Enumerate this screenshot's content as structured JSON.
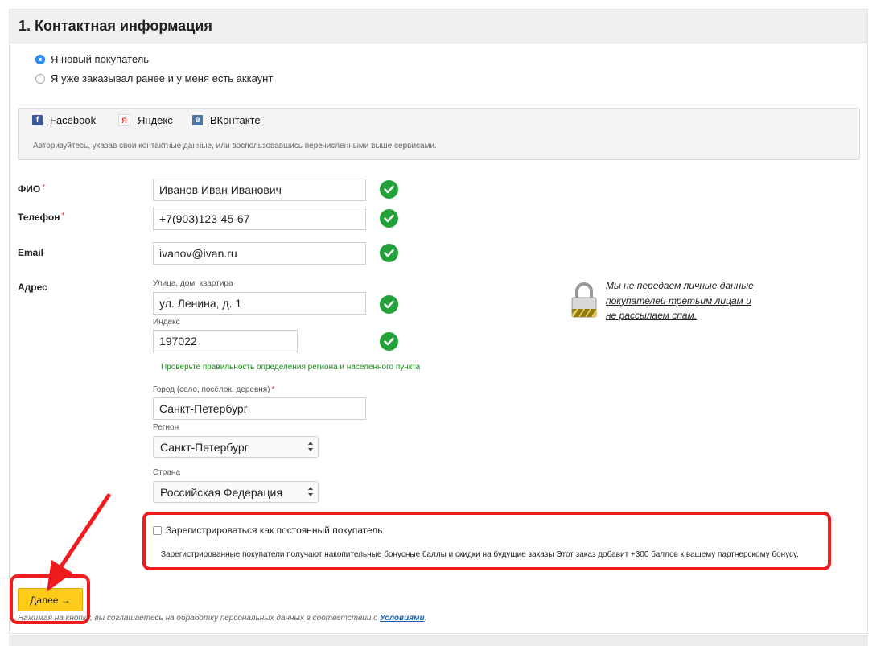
{
  "section": {
    "title": "1. Контактная информация"
  },
  "customer_type": {
    "options": [
      {
        "label": "Я новый покупатель",
        "checked": true
      },
      {
        "label": "Я уже заказывал ранее и у меня есть аккаунт",
        "checked": false
      }
    ]
  },
  "social": {
    "links": [
      {
        "label": "Facebook",
        "icon": "facebook-icon"
      },
      {
        "label": "Яндекс",
        "icon": "yandex-icon"
      },
      {
        "label": "ВКонтакте",
        "icon": "vk-icon"
      }
    ],
    "hint": "Авторизуйтесь, указав свои контактные данные, или воспользовавшись перечисленными выше сервисами."
  },
  "form": {
    "fio": {
      "label": "ФИО",
      "required_mark": "*",
      "value": "Иванов Иван Иванович"
    },
    "phone": {
      "label": "Телефон",
      "required_mark": "*",
      "value": "+7(903)123-45-67"
    },
    "email": {
      "label": "Email",
      "value": "ivanov@ivan.ru"
    },
    "address": {
      "label": "Адрес",
      "street": {
        "label": "Улица, дом, квартира",
        "value": "ул. Ленина, д. 1"
      },
      "zip": {
        "label": "Индекс",
        "value": "197022"
      },
      "verify_message": "Проверьте правильность определения региона и населенного пункта",
      "city": {
        "label": "Город (село, посёлок, деревня)",
        "required_mark": "*",
        "value": "Санкт-Петербург"
      },
      "region": {
        "label": "Регион",
        "value": "Санкт-Петербург"
      },
      "country": {
        "label": "Страна",
        "value": "Российская Федерация"
      }
    }
  },
  "privacy": {
    "text": "Мы не передаем личные данные покупателей третьим лицам и не рассылаем спам."
  },
  "registration": {
    "checkbox_label": "Зарегистрироваться как постоянный покупатель",
    "checked": false,
    "description": "Зарегистрированные покупатели получают накопительные бонусные баллы и скидки на будущие заказы Этот заказ добавит +300 баллов к вашему партнерскому бонусу."
  },
  "next_button": {
    "label": "Далее →"
  },
  "consent": {
    "text": "Нажимая на кнопку, вы соглашаетесь на обработку персональных данных в соответствии с ",
    "link": "Условиями",
    "suffix": "."
  },
  "colors": {
    "accent_yellow": "#ffcb1a",
    "highlight_red": "#ee1c1c",
    "valid_green": "#23a23a",
    "radio_blue": "#2a8ef5"
  }
}
